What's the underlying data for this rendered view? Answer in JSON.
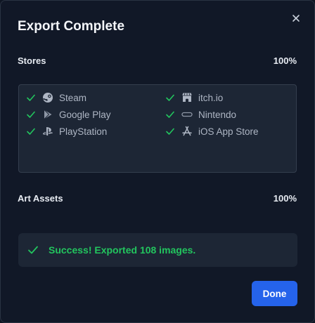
{
  "dialog": {
    "title": "Export Complete",
    "close_icon": "close-icon"
  },
  "stores": {
    "label": "Stores",
    "percent": "100%",
    "items": [
      {
        "label": "Steam",
        "icon": "steam-icon",
        "status": "check-icon"
      },
      {
        "label": "Google Play",
        "icon": "google-play-icon",
        "status": "check-icon"
      },
      {
        "label": "PlayStation",
        "icon": "playstation-icon",
        "status": "check-icon"
      },
      {
        "label": "itch.io",
        "icon": "itch-io-icon",
        "status": "check-icon"
      },
      {
        "label": "Nintendo",
        "icon": "nintendo-icon",
        "status": "check-icon"
      },
      {
        "label": "iOS App Store",
        "icon": "app-store-icon",
        "status": "check-icon"
      }
    ]
  },
  "art_assets": {
    "label": "Art Assets",
    "percent": "100%"
  },
  "result": {
    "message": "Success! Exported 108 images.",
    "icon": "check-icon"
  },
  "actions": {
    "done_label": "Done"
  },
  "colors": {
    "background": "#111827",
    "panel": "#1d2635",
    "success": "#22c55e",
    "accent": "#2563eb"
  }
}
